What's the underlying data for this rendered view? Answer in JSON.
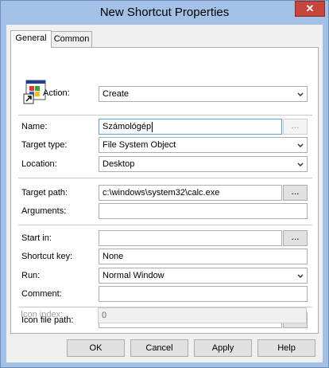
{
  "window": {
    "title": "New Shortcut Properties",
    "close_glyph": "✕"
  },
  "tabs": [
    "General",
    "Common"
  ],
  "general": {
    "action_label": "Action:",
    "action_value": "Create",
    "name_label": "Name:",
    "name_value": "Számológép",
    "target_type_label": "Target type:",
    "target_type_value": "File System Object",
    "location_label": "Location:",
    "location_value": "Desktop",
    "target_path_label": "Target path:",
    "target_path_value": "c:\\windows\\system32\\calc.exe",
    "arguments_label": "Arguments:",
    "arguments_value": "",
    "start_in_label": "Start in:",
    "start_in_value": "",
    "shortcut_key_label": "Shortcut key:",
    "shortcut_key_value": "None",
    "run_label": "Run:",
    "run_value": "Normal Window",
    "comment_label": "Comment:",
    "comment_value": "",
    "icon_path_label": "Icon file path:",
    "icon_path_value": "",
    "icon_index_label": "Icon index:",
    "icon_index_value": "0",
    "browse_label": "..."
  },
  "buttons": {
    "ok": "OK",
    "cancel": "Cancel",
    "apply": "Apply",
    "help": "Help"
  },
  "colors": {
    "title_bar": "#a3c0e6",
    "close_button": "#c7463c",
    "focus_border": "#569de5"
  },
  "icons": {
    "shortcut": "shortcut-app-icon",
    "dropdown": "chevron-down-icon",
    "close": "close-icon"
  }
}
